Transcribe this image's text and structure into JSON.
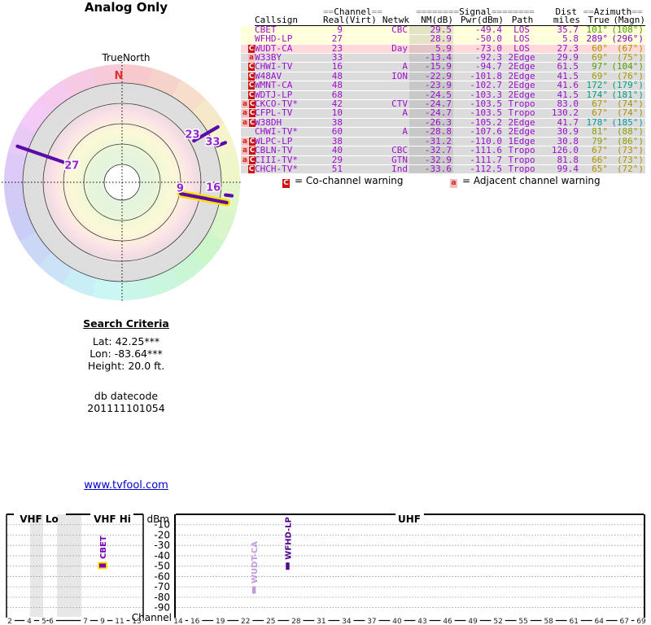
{
  "link": {
    "text": "www.tvfool.com"
  },
  "search": {
    "title": "Search Criteria",
    "lines": [
      "Lat: 42.25***",
      "Lon: -83.64***",
      "Height: 20.0 ft."
    ],
    "datecode_label": "db datecode",
    "datecode": "201111101054"
  },
  "table": {
    "group_headers": [
      {
        "eq_left": "==",
        "text": "Channel",
        "eq_right": "=="
      },
      {
        "eq_left": "========",
        "text": "Signal",
        "eq_right": "========"
      },
      {
        "eq_left": "",
        "text": "Dist",
        "eq_right": ""
      },
      {
        "eq_left": "==",
        "text": "Azimuth",
        "eq_right": "=="
      }
    ],
    "column_headers": [
      "Callsign",
      "Real",
      "(Virt)",
      "Netwk",
      "NM(dB)",
      "Pwr(dBm)",
      "Path",
      "miles",
      "True",
      "(Magn)"
    ],
    "text_color": "#9a10cc",
    "rows": [
      {
        "w": [],
        "cs": "CBET",
        "real": "9",
        "virt": "",
        "netwk": "CBC",
        "nm": "29.5",
        "pwr": "-49.4",
        "path": "LOS",
        "mi": "35.7",
        "az_t": "101°",
        "az_m": "(108°)",
        "az_c": "#4aa000",
        "bg": "#ffffd9"
      },
      {
        "w": [],
        "cs": "WFHD-LP",
        "real": "27",
        "virt": "",
        "netwk": "",
        "nm": "28.9",
        "pwr": "-50.0",
        "path": "LOS",
        "mi": "5.8",
        "az_t": "289°",
        "az_m": "(296°)",
        "az_c": "#8400c8",
        "bg": "#ffffd9"
      },
      {
        "w": [
          "C"
        ],
        "cs": "WUDT-CA",
        "real": "23",
        "virt": "",
        "netwk": "Day",
        "nm": "5.9",
        "pwr": "-73.0",
        "path": "LOS",
        "mi": "27.3",
        "az_t": "60°",
        "az_m": "(67°)",
        "az_c": "#b08c00",
        "bg": "#ffd9d9"
      },
      {
        "w": [
          "a"
        ],
        "cs": "W33BY",
        "real": "33",
        "virt": "",
        "netwk": "",
        "nm": "-13.4",
        "pwr": "-92.3",
        "path": "2Edge",
        "mi": "29.9",
        "az_t": "69°",
        "az_m": "(75°)",
        "az_c": "#a29a00",
        "bg": "#dcdcdc"
      },
      {
        "w": [
          "C"
        ],
        "cs": "CHWI-TV",
        "real": "16",
        "virt": "",
        "netwk": "A",
        "nm": "-15.9",
        "pwr": "-94.7",
        "path": "2Edge",
        "mi": "61.5",
        "az_t": "97°",
        "az_m": "(104°)",
        "az_c": "#55a000",
        "bg": "#dcdcdc"
      },
      {
        "w": [
          "C"
        ],
        "cs": "W48AV",
        "real": "48",
        "virt": "",
        "netwk": "ION",
        "nm": "-22.9",
        "pwr": "-101.8",
        "path": "2Edge",
        "mi": "41.5",
        "az_t": "69°",
        "az_m": "(76°)",
        "az_c": "#a29a00",
        "bg": "#dcdcdc"
      },
      {
        "w": [
          "C"
        ],
        "cs": "WMNT-CA",
        "real": "48",
        "virt": "",
        "netwk": "",
        "nm": "-23.9",
        "pwr": "-102.7",
        "path": "2Edge",
        "mi": "41.6",
        "az_t": "172°",
        "az_m": "(179°)",
        "az_c": "#00a07c",
        "bg": "#dcdcdc"
      },
      {
        "w": [
          "C"
        ],
        "cs": "WDTJ-LP",
        "real": "68",
        "virt": "",
        "netwk": "",
        "nm": "-24.5",
        "pwr": "-103.3",
        "path": "2Edge",
        "mi": "41.5",
        "az_t": "174°",
        "az_m": "(181°)",
        "az_c": "#009e85",
        "bg": "#dcdcdc"
      },
      {
        "w": [
          "a",
          "C"
        ],
        "cs": "CKCO-TV*",
        "real": "42",
        "virt": "",
        "netwk": "CTV",
        "nm": "-24.7",
        "pwr": "-103.5",
        "path": "Tropo",
        "mi": "83.0",
        "az_t": "67°",
        "az_m": "(74°)",
        "az_c": "#aa9100",
        "bg": "#dcdcdc"
      },
      {
        "w": [
          "a",
          "C"
        ],
        "cs": "CFPL-TV",
        "real": "10",
        "virt": "",
        "netwk": "A",
        "nm": "-24.7",
        "pwr": "-103.5",
        "path": "Tropo",
        "mi": "130.2",
        "az_t": "67°",
        "az_m": "(74°)",
        "az_c": "#aa9100",
        "bg": "#dcdcdc"
      },
      {
        "w": [
          "a",
          "C"
        ],
        "cs": "W38DH",
        "real": "38",
        "virt": "",
        "netwk": "",
        "nm": "-26.3",
        "pwr": "-105.2",
        "path": "2Edge",
        "mi": "41.7",
        "az_t": "178°",
        "az_m": "(185°)",
        "az_c": "#009aa0",
        "bg": "#dcdcdc"
      },
      {
        "w": [],
        "cs": "CHWI-TV*",
        "real": "60",
        "virt": "",
        "netwk": "A",
        "nm": "-28.8",
        "pwr": "-107.6",
        "path": "2Edge",
        "mi": "30.9",
        "az_t": "81°",
        "az_m": "(88°)",
        "az_c": "#8f9e00",
        "bg": "#dcdcdc"
      },
      {
        "w": [
          "a",
          "C"
        ],
        "cs": "WLPC-LP",
        "real": "38",
        "virt": "",
        "netwk": "",
        "nm": "-31.2",
        "pwr": "-110.0",
        "path": "1Edge",
        "mi": "30.8",
        "az_t": "79°",
        "az_m": "(86°)",
        "az_c": "#939c00",
        "bg": "#dcdcdc"
      },
      {
        "w": [
          "a",
          "C"
        ],
        "cs": "CBLN-TV",
        "real": "40",
        "virt": "",
        "netwk": "CBC",
        "nm": "-32.7",
        "pwr": "-111.6",
        "path": "Tropo",
        "mi": "126.0",
        "az_t": "67°",
        "az_m": "(73°)",
        "az_c": "#aa9100",
        "bg": "#dcdcdc"
      },
      {
        "w": [
          "a",
          "C"
        ],
        "cs": "CIII-TV*",
        "real": "29",
        "virt": "",
        "netwk": "GTN",
        "nm": "-32.9",
        "pwr": "-111.7",
        "path": "Tropo",
        "mi": "81.8",
        "az_t": "66°",
        "az_m": "(73°)",
        "az_c": "#ab9300",
        "bg": "#dcdcdc"
      },
      {
        "w": [
          "C"
        ],
        "cs": "CHCH-TV*",
        "real": "51",
        "virt": "",
        "netwk": "Ind",
        "nm": "-33.6",
        "pwr": "-112.5",
        "path": "Tropo",
        "mi": "99.4",
        "az_t": "65°",
        "az_m": "(72°)",
        "az_c": "#ac9200",
        "bg": "#dcdcdc"
      }
    ],
    "warning_styles": {
      "C": {
        "bg": "#cc1111",
        "fg": "#ffffff"
      },
      "a": {
        "bg": "#f5bcbc",
        "fg": "#cc2222"
      }
    },
    "legend": [
      {
        "symbol": "C",
        "label": "= Co-channel warning"
      },
      {
        "symbol": "a",
        "label": "= Adjacent channel warning"
      }
    ]
  },
  "chart_data": [
    {
      "type": "radar",
      "title": "Analog Only",
      "north_label": "TrueNorth",
      "n_marker": "N",
      "rings": 5,
      "ring_note": "pastel radial bands: white center, green, yellow, pink, gray, outer hue-by-azimuth rainbow ring",
      "spoke_color": "#5a0ba8",
      "highlight_color": "#ffdf00",
      "spokes": [
        {
          "channel": "9",
          "callsign": "CBET",
          "azimuth_true": 101,
          "nm_db": 29.5,
          "highlight": true
        },
        {
          "channel": "16",
          "callsign": "CHWI-TV",
          "azimuth_true": 97,
          "nm_db": -15.9,
          "highlight": false
        },
        {
          "channel": "23",
          "callsign": "WUDT-CA",
          "azimuth_true": 60,
          "nm_db": 5.9,
          "highlight": false
        },
        {
          "channel": "33",
          "callsign": "W33BY",
          "azimuth_true": 69,
          "nm_db": -13.4,
          "highlight": false
        },
        {
          "channel": "27",
          "callsign": "WFHD-LP",
          "azimuth_true": 289,
          "nm_db": 28.9,
          "highlight": false
        }
      ]
    },
    {
      "type": "scatter",
      "panels": [
        {
          "label": "VHF Lo"
        },
        {
          "label": "VHF Hi"
        },
        {
          "label": "UHF"
        }
      ],
      "ylabel": "dBm",
      "xlabel": "Channel",
      "ylim": [
        0,
        -95
      ],
      "dbm_ticks": [
        -10,
        -20,
        -30,
        -40,
        -50,
        -60,
        -70,
        -80,
        -90
      ],
      "vhf_channel_ticks": [
        2,
        4,
        5,
        6,
        7,
        9,
        11,
        13
      ],
      "uhf_channel_ticks": [
        14,
        16,
        19,
        22,
        25,
        28,
        31,
        34,
        37,
        40,
        43,
        46,
        49,
        52,
        55,
        58,
        61,
        64,
        67,
        69
      ],
      "points": [
        {
          "callsign": "CBET",
          "channel": 9,
          "dbm": -49.4,
          "color": "#7a00b8",
          "highlight": true
        },
        {
          "callsign": "WUDT-CA",
          "channel": 23,
          "dbm": -73.0,
          "color": "#c49add",
          "highlight": false
        },
        {
          "callsign": "WFHD-LP",
          "channel": 27,
          "dbm": -50.0,
          "color": "#50058f",
          "highlight": false
        }
      ]
    }
  ]
}
